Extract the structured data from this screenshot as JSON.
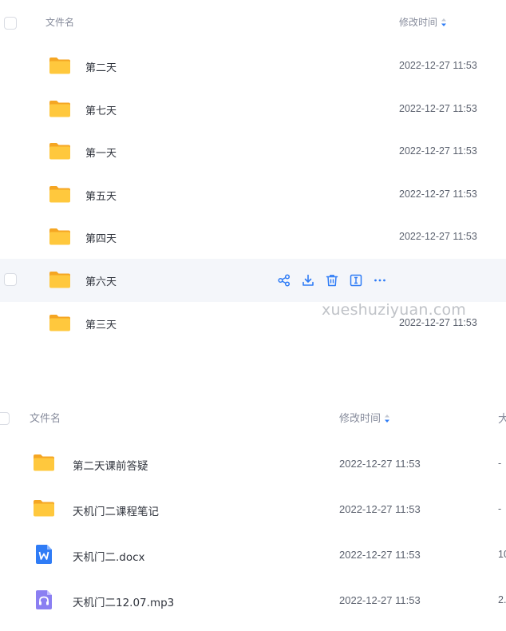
{
  "panel1": {
    "header": {
      "name_label": "文件名",
      "time_label": "修改时间"
    },
    "rows": [
      {
        "name": "第二天",
        "time": "2022-12-27 11:53"
      },
      {
        "name": "第七天",
        "time": "2022-12-27 11:53"
      },
      {
        "name": "第一天",
        "time": "2022-12-27 11:53"
      },
      {
        "name": "第五天",
        "time": "2022-12-27 11:53"
      },
      {
        "name": "第四天",
        "time": "2022-12-27 11:53"
      },
      {
        "name": "第六天",
        "time": ""
      },
      {
        "name": "第三天",
        "time": "2022-12-27 11:53"
      }
    ],
    "hover_actions": [
      "share-icon",
      "download-icon",
      "delete-icon",
      "rename-icon",
      "more-icon"
    ]
  },
  "watermark": "xueshuziyuan.com",
  "panel2": {
    "header": {
      "name_label": "文件名",
      "time_label": "修改时间",
      "size_label_cut": "大"
    },
    "rows": [
      {
        "name": "第二天课前答疑",
        "time": "2022-12-27 11:53",
        "size": "-",
        "icon": "folder-icon"
      },
      {
        "name": "天机门二课程笔记",
        "time": "2022-12-27 11:53",
        "size": "-",
        "icon": "folder-icon"
      },
      {
        "name": "天机门二.docx",
        "time": "2022-12-27 11:53",
        "size": "10",
        "icon": "word-doc-icon"
      },
      {
        "name": "天机门二12.07.mp3",
        "time": "2022-12-27 11:53",
        "size": "2.",
        "icon": "audio-file-icon"
      }
    ]
  },
  "colors": {
    "folder": "#ffc83d",
    "folder_tab": "#f5a623",
    "accent": "#2f7cf6",
    "hover_row": "#f4f6fa",
    "word": "#2f7cf6",
    "audio": "#8b7ff2"
  }
}
